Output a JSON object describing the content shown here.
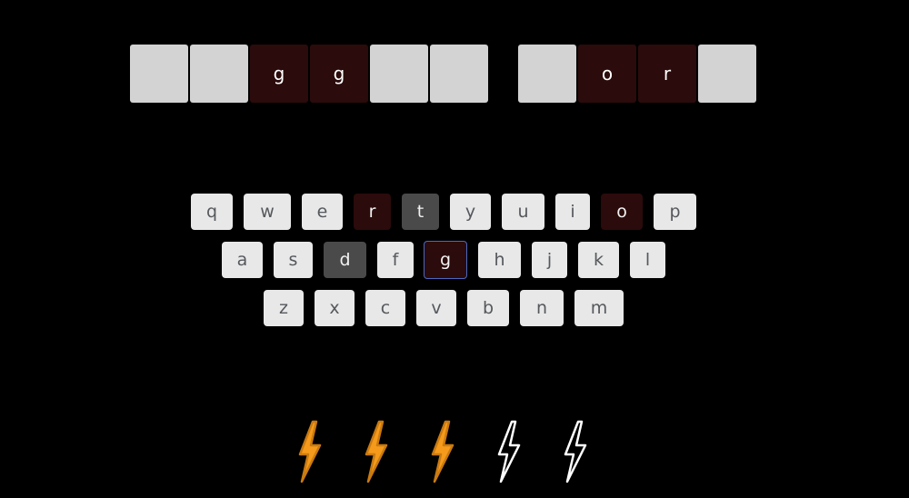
{
  "board": {
    "words": [
      [
        {
          "letter": "",
          "state": "empty"
        },
        {
          "letter": "",
          "state": "empty"
        },
        {
          "letter": "g",
          "state": "filled"
        },
        {
          "letter": "g",
          "state": "filled"
        },
        {
          "letter": "",
          "state": "empty"
        },
        {
          "letter": "",
          "state": "empty"
        }
      ],
      [
        {
          "letter": "",
          "state": "empty"
        },
        {
          "letter": "o",
          "state": "filled"
        },
        {
          "letter": "r",
          "state": "filled"
        },
        {
          "letter": "",
          "state": "empty"
        }
      ]
    ]
  },
  "keyboard": {
    "rows": [
      [
        {
          "key": "q",
          "state": "default"
        },
        {
          "key": "w",
          "state": "default"
        },
        {
          "key": "e",
          "state": "default"
        },
        {
          "key": "r",
          "state": "present"
        },
        {
          "key": "t",
          "state": "used"
        },
        {
          "key": "y",
          "state": "default"
        },
        {
          "key": "u",
          "state": "default"
        },
        {
          "key": "i",
          "state": "default"
        },
        {
          "key": "o",
          "state": "present"
        },
        {
          "key": "p",
          "state": "default"
        }
      ],
      [
        {
          "key": "a",
          "state": "default"
        },
        {
          "key": "s",
          "state": "default"
        },
        {
          "key": "d",
          "state": "used"
        },
        {
          "key": "f",
          "state": "default"
        },
        {
          "key": "g",
          "state": "selected"
        },
        {
          "key": "h",
          "state": "default"
        },
        {
          "key": "j",
          "state": "default"
        },
        {
          "key": "k",
          "state": "default"
        },
        {
          "key": "l",
          "state": "default"
        }
      ],
      [
        {
          "key": "z",
          "state": "default"
        },
        {
          "key": "x",
          "state": "default"
        },
        {
          "key": "c",
          "state": "default"
        },
        {
          "key": "v",
          "state": "default"
        },
        {
          "key": "b",
          "state": "default"
        },
        {
          "key": "n",
          "state": "default"
        },
        {
          "key": "m",
          "state": "default"
        }
      ]
    ]
  },
  "lives": {
    "total": 5,
    "remaining": 3
  },
  "colors": {
    "background": "#000000",
    "tile_empty": "#d3d3d3",
    "tile_filled": "#2b0b0b",
    "key_default": "#e8e8e8",
    "key_present": "#2b0b0b",
    "key_used": "#4a4a4a",
    "key_selected_border": "#4a68c0",
    "bolt_active": "#f59a1b",
    "bolt_inactive": "#ffffff"
  }
}
